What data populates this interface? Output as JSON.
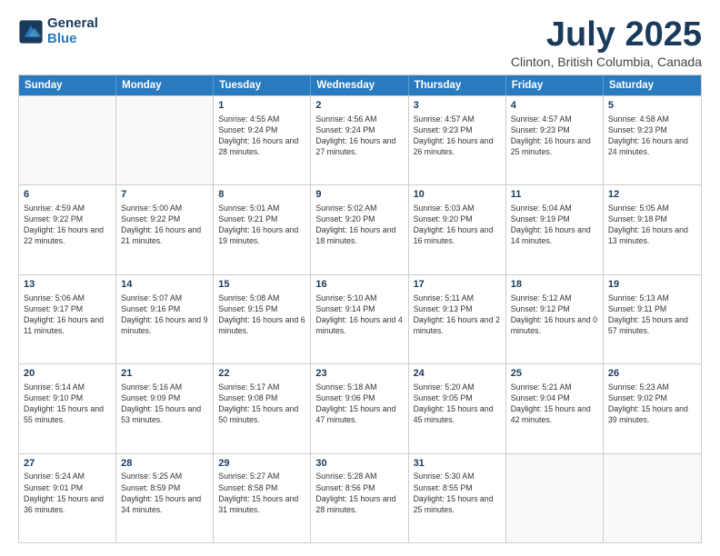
{
  "logo": {
    "line1": "General",
    "line2": "Blue"
  },
  "title": "July 2025",
  "subtitle": "Clinton, British Columbia, Canada",
  "days": [
    "Sunday",
    "Monday",
    "Tuesday",
    "Wednesday",
    "Thursday",
    "Friday",
    "Saturday"
  ],
  "weeks": [
    [
      {
        "day": "",
        "empty": true
      },
      {
        "day": "",
        "empty": true
      },
      {
        "day": "1",
        "sunrise": "4:55 AM",
        "sunset": "9:24 PM",
        "daylight": "16 hours and 28 minutes."
      },
      {
        "day": "2",
        "sunrise": "4:56 AM",
        "sunset": "9:24 PM",
        "daylight": "16 hours and 27 minutes."
      },
      {
        "day": "3",
        "sunrise": "4:57 AM",
        "sunset": "9:23 PM",
        "daylight": "16 hours and 26 minutes."
      },
      {
        "day": "4",
        "sunrise": "4:57 AM",
        "sunset": "9:23 PM",
        "daylight": "16 hours and 25 minutes."
      },
      {
        "day": "5",
        "sunrise": "4:58 AM",
        "sunset": "9:23 PM",
        "daylight": "16 hours and 24 minutes."
      }
    ],
    [
      {
        "day": "6",
        "sunrise": "4:59 AM",
        "sunset": "9:22 PM",
        "daylight": "16 hours and 22 minutes."
      },
      {
        "day": "7",
        "sunrise": "5:00 AM",
        "sunset": "9:22 PM",
        "daylight": "16 hours and 21 minutes."
      },
      {
        "day": "8",
        "sunrise": "5:01 AM",
        "sunset": "9:21 PM",
        "daylight": "16 hours and 19 minutes."
      },
      {
        "day": "9",
        "sunrise": "5:02 AM",
        "sunset": "9:20 PM",
        "daylight": "16 hours and 18 minutes."
      },
      {
        "day": "10",
        "sunrise": "5:03 AM",
        "sunset": "9:20 PM",
        "daylight": "16 hours and 16 minutes."
      },
      {
        "day": "11",
        "sunrise": "5:04 AM",
        "sunset": "9:19 PM",
        "daylight": "16 hours and 14 minutes."
      },
      {
        "day": "12",
        "sunrise": "5:05 AM",
        "sunset": "9:18 PM",
        "daylight": "16 hours and 13 minutes."
      }
    ],
    [
      {
        "day": "13",
        "sunrise": "5:06 AM",
        "sunset": "9:17 PM",
        "daylight": "16 hours and 11 minutes."
      },
      {
        "day": "14",
        "sunrise": "5:07 AM",
        "sunset": "9:16 PM",
        "daylight": "16 hours and 9 minutes."
      },
      {
        "day": "15",
        "sunrise": "5:08 AM",
        "sunset": "9:15 PM",
        "daylight": "16 hours and 6 minutes."
      },
      {
        "day": "16",
        "sunrise": "5:10 AM",
        "sunset": "9:14 PM",
        "daylight": "16 hours and 4 minutes."
      },
      {
        "day": "17",
        "sunrise": "5:11 AM",
        "sunset": "9:13 PM",
        "daylight": "16 hours and 2 minutes."
      },
      {
        "day": "18",
        "sunrise": "5:12 AM",
        "sunset": "9:12 PM",
        "daylight": "16 hours and 0 minutes."
      },
      {
        "day": "19",
        "sunrise": "5:13 AM",
        "sunset": "9:11 PM",
        "daylight": "15 hours and 57 minutes."
      }
    ],
    [
      {
        "day": "20",
        "sunrise": "5:14 AM",
        "sunset": "9:10 PM",
        "daylight": "15 hours and 55 minutes."
      },
      {
        "day": "21",
        "sunrise": "5:16 AM",
        "sunset": "9:09 PM",
        "daylight": "15 hours and 53 minutes."
      },
      {
        "day": "22",
        "sunrise": "5:17 AM",
        "sunset": "9:08 PM",
        "daylight": "15 hours and 50 minutes."
      },
      {
        "day": "23",
        "sunrise": "5:18 AM",
        "sunset": "9:06 PM",
        "daylight": "15 hours and 47 minutes."
      },
      {
        "day": "24",
        "sunrise": "5:20 AM",
        "sunset": "9:05 PM",
        "daylight": "15 hours and 45 minutes."
      },
      {
        "day": "25",
        "sunrise": "5:21 AM",
        "sunset": "9:04 PM",
        "daylight": "15 hours and 42 minutes."
      },
      {
        "day": "26",
        "sunrise": "5:23 AM",
        "sunset": "9:02 PM",
        "daylight": "15 hours and 39 minutes."
      }
    ],
    [
      {
        "day": "27",
        "sunrise": "5:24 AM",
        "sunset": "9:01 PM",
        "daylight": "15 hours and 36 minutes."
      },
      {
        "day": "28",
        "sunrise": "5:25 AM",
        "sunset": "8:59 PM",
        "daylight": "15 hours and 34 minutes."
      },
      {
        "day": "29",
        "sunrise": "5:27 AM",
        "sunset": "8:58 PM",
        "daylight": "15 hours and 31 minutes."
      },
      {
        "day": "30",
        "sunrise": "5:28 AM",
        "sunset": "8:56 PM",
        "daylight": "15 hours and 28 minutes."
      },
      {
        "day": "31",
        "sunrise": "5:30 AM",
        "sunset": "8:55 PM",
        "daylight": "15 hours and 25 minutes."
      },
      {
        "day": "",
        "empty": true
      },
      {
        "day": "",
        "empty": true
      }
    ]
  ]
}
